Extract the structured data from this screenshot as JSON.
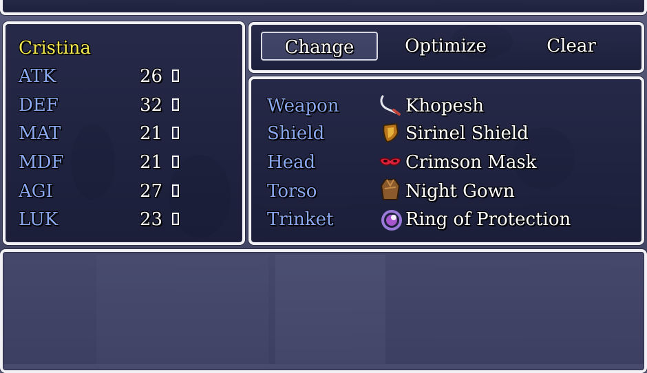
{
  "actor": {
    "name": "Cristina"
  },
  "stats": [
    {
      "label": "ATK",
      "value": "26",
      "arrow": ""
    },
    {
      "label": "DEF",
      "value": "32",
      "arrow": ""
    },
    {
      "label": "MAT",
      "value": "21",
      "arrow": ""
    },
    {
      "label": "MDF",
      "value": "21",
      "arrow": ""
    },
    {
      "label": "AGI",
      "value": "27",
      "arrow": ""
    },
    {
      "label": "LUK",
      "value": "23",
      "arrow": ""
    }
  ],
  "commands": {
    "change": "Change",
    "optimize": "Optimize",
    "clear": "Clear",
    "selected": "change"
  },
  "equipment": [
    {
      "slot": "Weapon",
      "item": "Khopesh",
      "icon": "khopesh-icon"
    },
    {
      "slot": "Shield",
      "item": "Sirinel Shield",
      "icon": "shield-icon"
    },
    {
      "slot": "Head",
      "item": "Crimson Mask",
      "icon": "mask-icon"
    },
    {
      "slot": "Torso",
      "item": "Night Gown",
      "icon": "robe-icon"
    },
    {
      "slot": "Trinket",
      "item": "Ring of Protection",
      "icon": "ring-icon"
    }
  ],
  "help": {
    "text": ""
  }
}
